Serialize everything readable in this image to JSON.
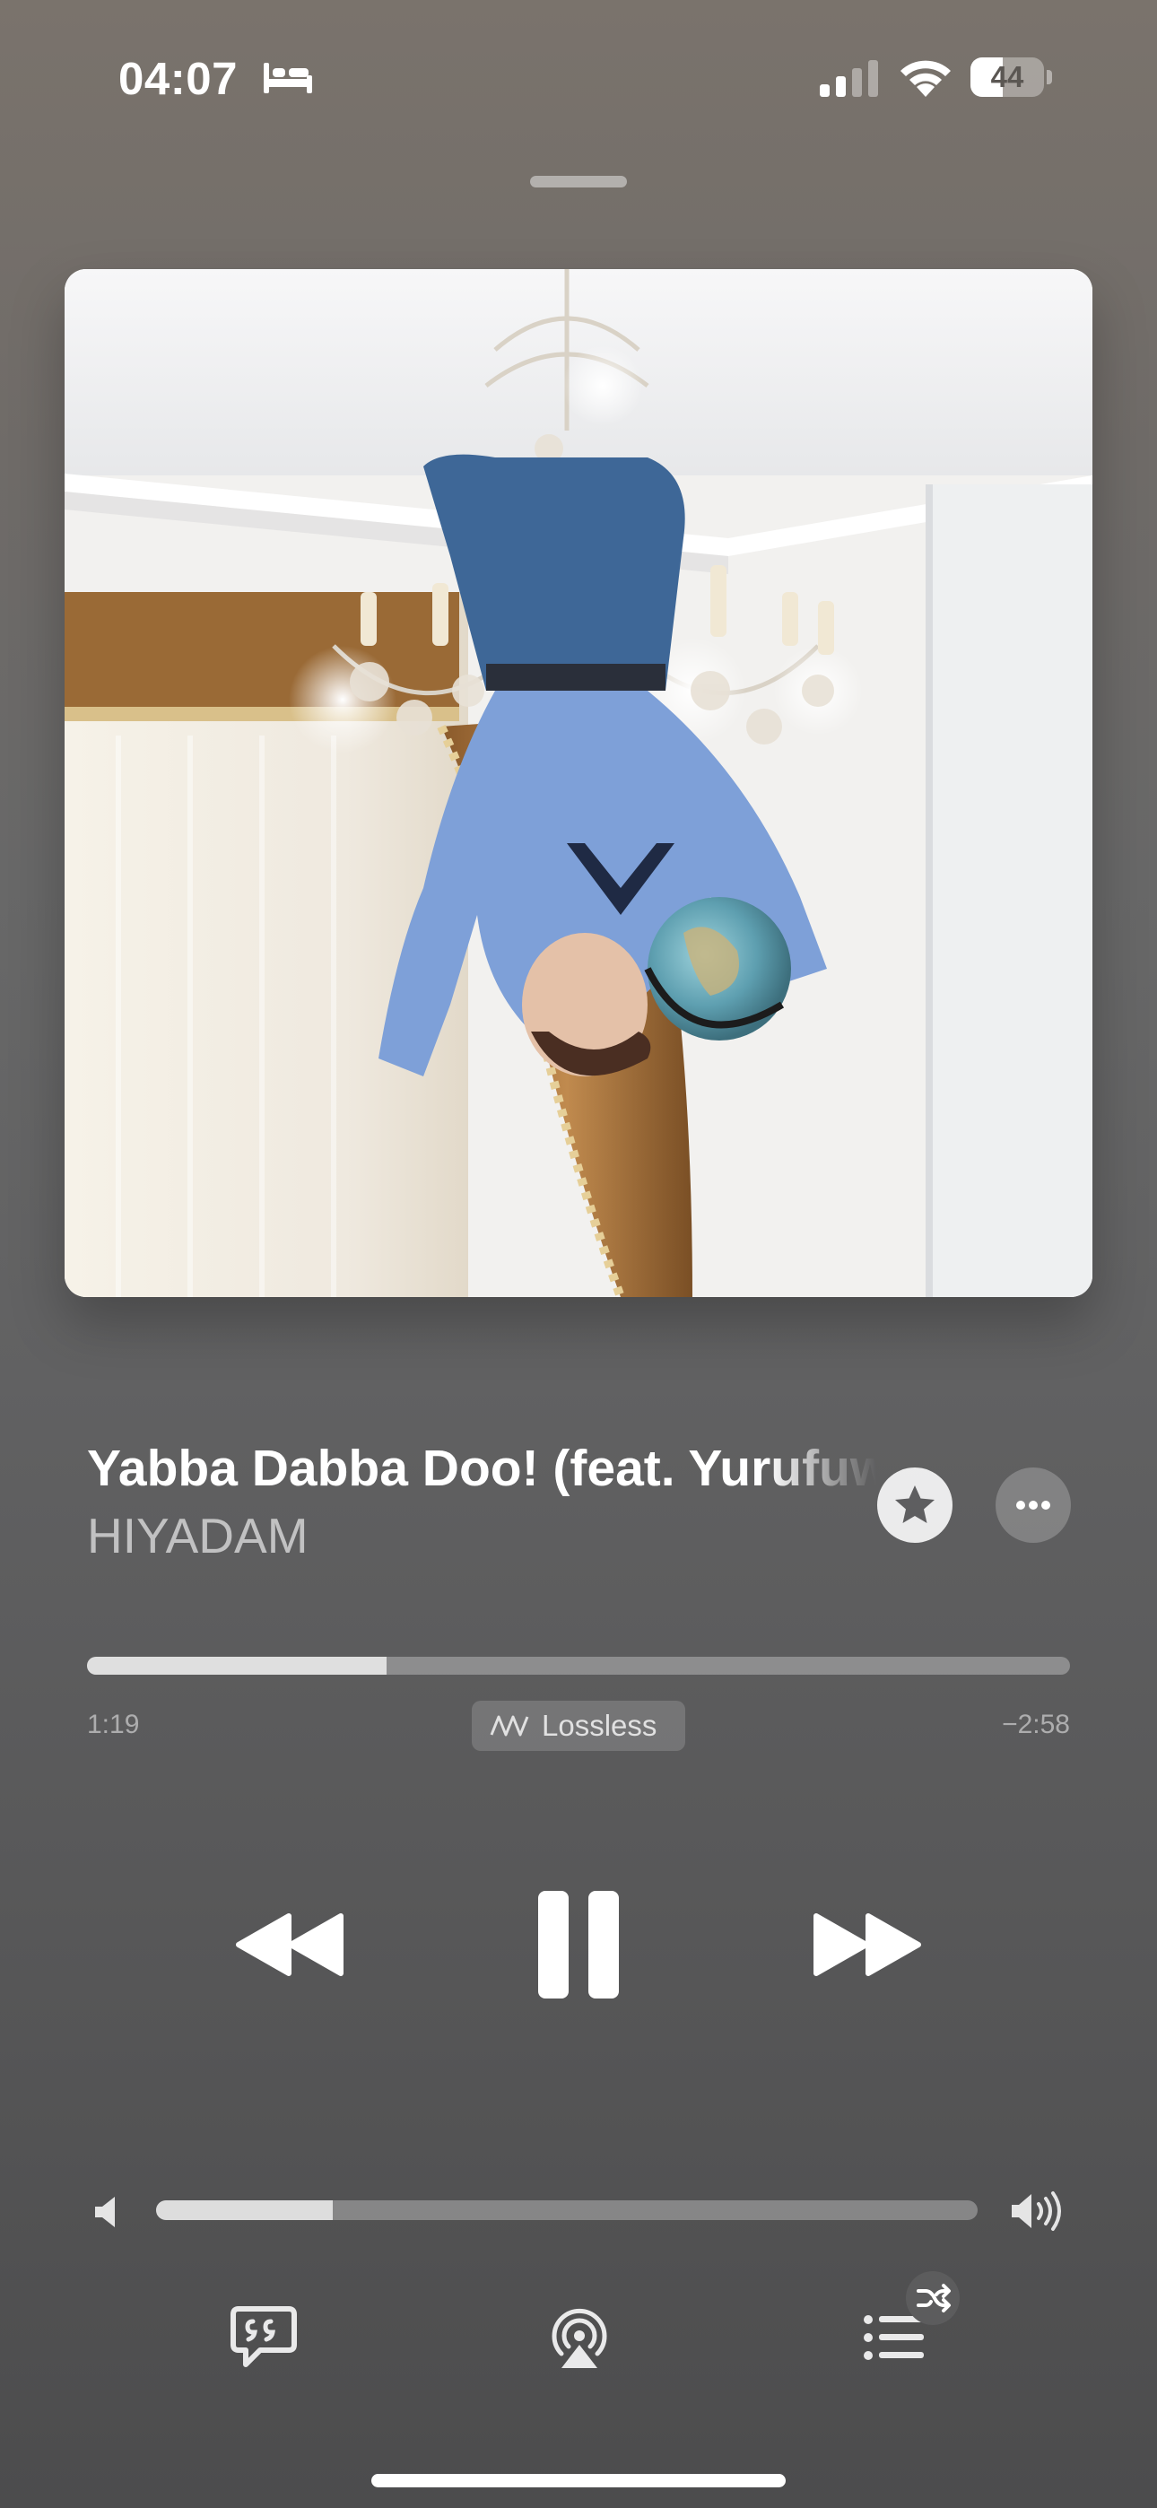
{
  "status_bar": {
    "time": "04:07",
    "focus_icon": "bed-icon",
    "signal_icon": "cellular-signal-icon",
    "wifi_icon": "wifi-icon",
    "battery_percent": "44",
    "battery_level": 0.44
  },
  "now_playing": {
    "artwork": "album-artwork",
    "title": "Yabba Dabba Doo! (feat. Yurufuwa Gang)",
    "artist": "HIYADAM",
    "favorite_icon": "star-icon",
    "more_icon": "ellipsis-icon"
  },
  "progress": {
    "elapsed": "1:19",
    "remaining": "−2:58",
    "fraction": 0.305,
    "quality_badge": "Lossless",
    "quality_icon": "lossless-wave-icon"
  },
  "controls": {
    "previous_icon": "rewind-icon",
    "play_pause_icon": "pause-icon",
    "next_icon": "fast-forward-icon"
  },
  "volume": {
    "level": 0.215,
    "min_icon": "speaker-low-icon",
    "max_icon": "speaker-high-icon"
  },
  "bottom_bar": {
    "lyrics_icon": "lyrics-quote-icon",
    "airplay_icon": "airplay-icon",
    "queue_icon": "queue-list-icon",
    "shuffle_icon": "shuffle-icon"
  },
  "colors": {
    "background_top": "#7a736c",
    "background_bottom": "#4c4c4d",
    "primary_text": "#ffffff"
  }
}
